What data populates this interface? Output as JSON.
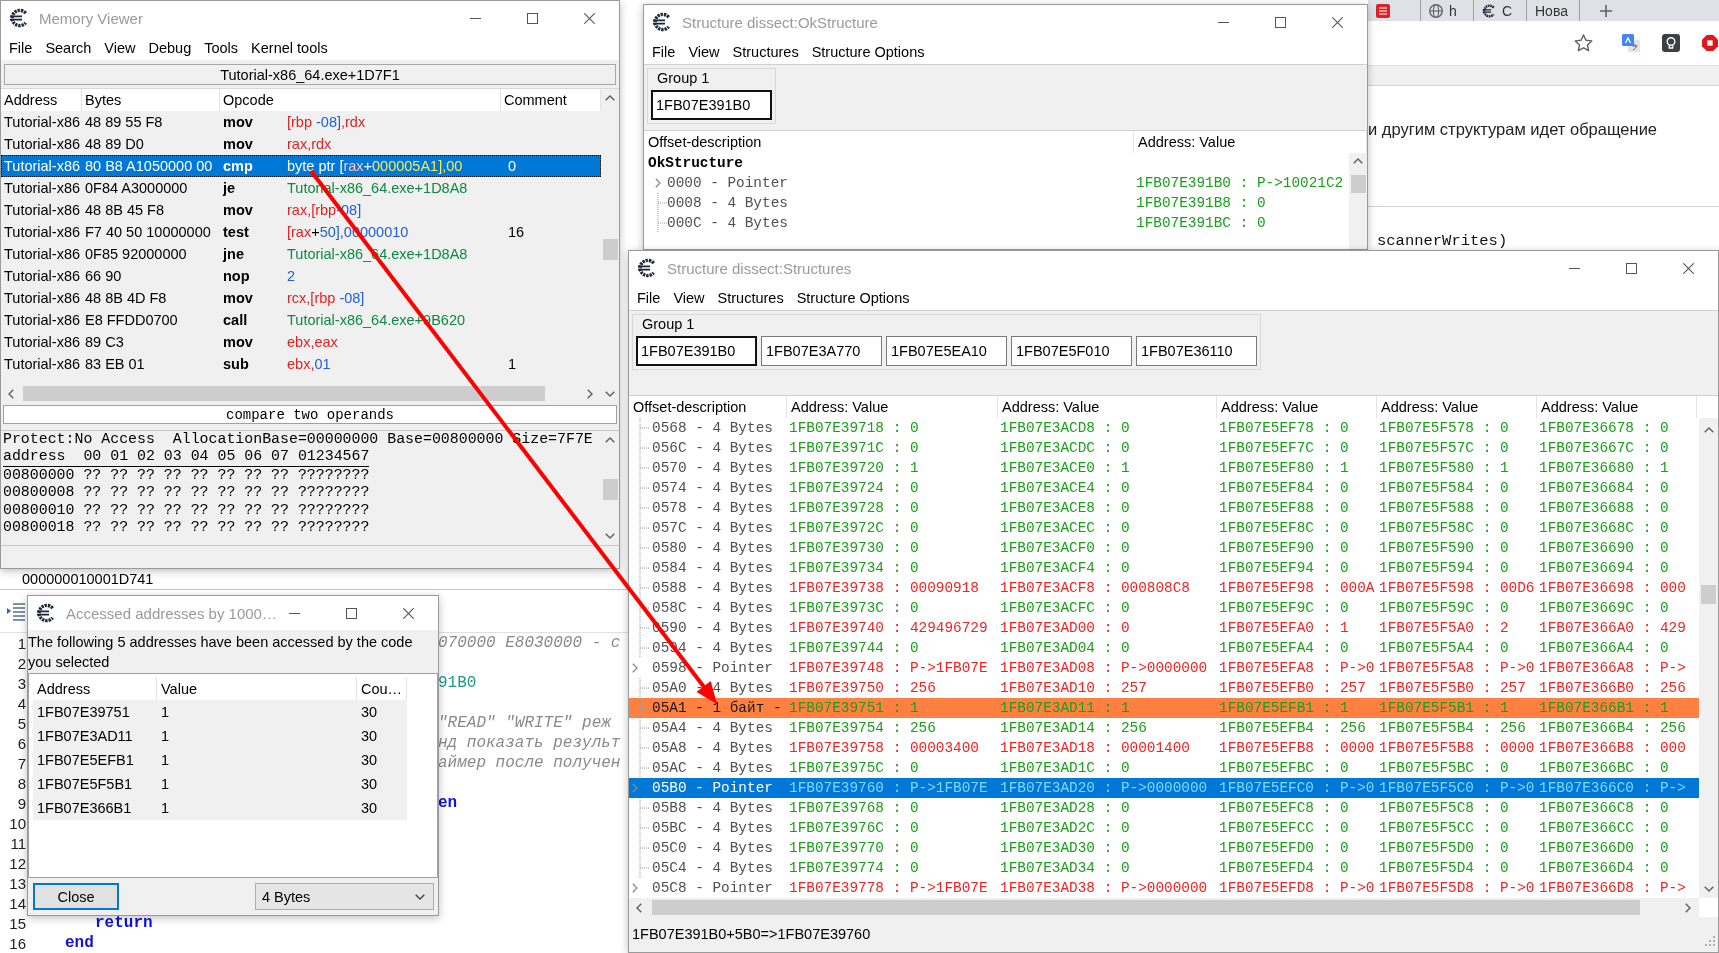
{
  "memory_viewer": {
    "title": "Memory Viewer",
    "menu": [
      "File",
      "Search",
      "View",
      "Debug",
      "Tools",
      "Kernel tools"
    ],
    "location": "Tutorial-x86_64.exe+1D7F1",
    "columns": [
      "Address",
      "Bytes",
      "Opcode",
      "Comment"
    ],
    "rows": [
      {
        "address": "Tutorial-x86",
        "bytes": "48 89 55 F8",
        "mnemonic": "mov",
        "operands": [
          {
            "kind": "reg",
            "text": "[rbp "
          },
          {
            "kind": "num",
            "text": "-08]"
          },
          {
            "kind": "reg",
            "text": ",rdx"
          }
        ],
        "selected": false
      },
      {
        "address": "Tutorial-x86",
        "bytes": "48 89 D0",
        "mnemonic": "mov",
        "operands": [
          {
            "kind": "reg",
            "text": "rax,rdx"
          }
        ],
        "selected": false
      },
      {
        "address": "Tutorial-x86",
        "bytes": "80 B8 A1050000 00",
        "mnemonic": "cmp",
        "operands": [
          {
            "kind": "txt",
            "text": "byte ptr ["
          },
          {
            "kind": "reg",
            "text": "rax"
          },
          {
            "kind": "txt",
            "text": "+"
          },
          {
            "kind": "num",
            "text": "000005A1],00"
          }
        ],
        "comment": "0",
        "selected": true
      },
      {
        "address": "Tutorial-x86",
        "bytes": "0F84 A3000000",
        "mnemonic": "je",
        "operands": [
          {
            "kind": "sym",
            "text": "Tutorial-x86_64.exe+1D8A8"
          }
        ],
        "selected": false
      },
      {
        "address": "Tutorial-x86",
        "bytes": "48 8B 45 F8",
        "mnemonic": "mov",
        "operands": [
          {
            "kind": "reg",
            "text": "rax,[rbp"
          },
          {
            "kind": "num",
            "text": "-08]"
          }
        ],
        "selected": false
      },
      {
        "address": "Tutorial-x86",
        "bytes": "F7 40 50 10000000",
        "mnemonic": "test",
        "operands": [
          {
            "kind": "reg",
            "text": "[rax"
          },
          {
            "kind": "txt",
            "text": "+"
          },
          {
            "kind": "num",
            "text": "50],00000010"
          }
        ],
        "comment": "16",
        "selected": false
      },
      {
        "address": "Tutorial-x86",
        "bytes": "0F85 92000000",
        "mnemonic": "jne",
        "operands": [
          {
            "kind": "sym",
            "text": "Tutorial-x86_64.exe+1D8A8"
          }
        ],
        "selected": false
      },
      {
        "address": "Tutorial-x86",
        "bytes": "66 90",
        "mnemonic": "nop",
        "operands": [
          {
            "kind": "num",
            "text": "2"
          }
        ],
        "selected": false
      },
      {
        "address": "Tutorial-x86",
        "bytes": "48 8B 4D F8",
        "mnemonic": "mov",
        "operands": [
          {
            "kind": "reg",
            "text": "rcx,[rbp "
          },
          {
            "kind": "num",
            "text": "-08]"
          }
        ],
        "selected": false
      },
      {
        "address": "Tutorial-x86",
        "bytes": "E8 FFDD0700",
        "mnemonic": "call",
        "operands": [
          {
            "kind": "sym",
            "text": "Tutorial-x86_64.exe+9B620"
          }
        ],
        "selected": false
      },
      {
        "address": "Tutorial-x86",
        "bytes": "89 C3",
        "mnemonic": "mov",
        "operands": [
          {
            "kind": "reg",
            "text": "ebx,eax"
          }
        ],
        "selected": false
      },
      {
        "address": "Tutorial-x86",
        "bytes": "83 EB 01",
        "mnemonic": "sub",
        "operands": [
          {
            "kind": "reg",
            "text": "ebx,"
          },
          {
            "kind": "num",
            "text": "01"
          }
        ],
        "comment": "1",
        "selected": false
      }
    ],
    "description": "compare two operands",
    "hex_view": {
      "info": "Protect:No Access  AllocationBase=00000000 Base=00800000 Size=7F7E",
      "header": "address  00 01 02 03 04 05 06 07 01234567",
      "rows": [
        "00800000 ?? ?? ?? ?? ?? ?? ?? ?? ????????",
        "00800008 ?? ?? ?? ?? ?? ?? ?? ?? ????????",
        "00800010 ?? ?? ?? ?? ?? ?? ?? ?? ????????",
        "00800018 ?? ?? ?? ?? ?? ?? ?? ?? ????????"
      ]
    }
  },
  "ok_structure_window": {
    "title": "Structure dissect:OkStructure",
    "menu": [
      "File",
      "View",
      "Structures",
      "Structure Options"
    ],
    "group": {
      "label": "Group 1",
      "addresses": [
        {
          "text": "1FB07E391B0",
          "focused": true
        }
      ]
    },
    "columns": [
      "Offset-description",
      "Address: Value"
    ],
    "tree": {
      "name": "OkStructure",
      "children": [
        {
          "label": "0000 - Pointer",
          "expandable": true,
          "value": "1FB07E391B0 : P->10021C2"
        },
        {
          "label": "0008 - 4 Bytes",
          "expandable": false,
          "value": "1FB07E391B8 : 0"
        },
        {
          "label": "000C - 4 Bytes",
          "expandable": false,
          "value": "1FB07E391BC : 0"
        }
      ]
    }
  },
  "browser": {
    "tabs": [
      {
        "kind": "pinned"
      },
      {
        "kind": "web",
        "title": "h"
      },
      {
        "kind": "app",
        "title": "C"
      },
      {
        "kind": "blank",
        "title": "Нова"
      }
    ],
    "page_text": "и другим структурам идет обращение",
    "code_text": "scannerWrites)"
  },
  "structures_window": {
    "title": "Structure dissect:Structures",
    "menu": [
      "File",
      "View",
      "Structures",
      "Structure Options"
    ],
    "group": {
      "label": "Group 1",
      "addresses": [
        {
          "text": "1FB07E391B0",
          "focused": true
        },
        {
          "text": "1FB07E3A770",
          "focused": false
        },
        {
          "text": "1FB07E5EA10",
          "focused": false
        },
        {
          "text": "1FB07E5F010",
          "focused": false
        },
        {
          "text": "1FB07E36110",
          "focused": false
        }
      ]
    },
    "offset_column": "Offset-description",
    "value_columns": [
      "Address: Value",
      "Address: Value",
      "Address: Value",
      "Address: Value",
      "Address: Value"
    ],
    "rows": [
      {
        "offset": "0568 - 4 Bytes",
        "expandable": false,
        "differs": false,
        "marked": false,
        "selected": false,
        "cells": [
          "1FB07E39718 : 0",
          "1FB07E3ACD8 : 0",
          "1FB07E5EF78 : 0",
          "1FB07E5F578 : 0",
          "1FB07E36678 : 0"
        ]
      },
      {
        "offset": "056C - 4 Bytes",
        "expandable": false,
        "differs": false,
        "marked": false,
        "selected": false,
        "cells": [
          "1FB07E3971C : 0",
          "1FB07E3ACDC : 0",
          "1FB07E5EF7C : 0",
          "1FB07E5F57C : 0",
          "1FB07E3667C : 0"
        ]
      },
      {
        "offset": "0570 - 4 Bytes",
        "expandable": false,
        "differs": false,
        "marked": false,
        "selected": false,
        "cells": [
          "1FB07E39720 : 1",
          "1FB07E3ACE0 : 1",
          "1FB07E5EF80 : 1",
          "1FB07E5F580 : 1",
          "1FB07E36680 : 1"
        ]
      },
      {
        "offset": "0574 - 4 Bytes",
        "expandable": false,
        "differs": false,
        "marked": false,
        "selected": false,
        "cells": [
          "1FB07E39724 : 0",
          "1FB07E3ACE4 : 0",
          "1FB07E5EF84 : 0",
          "1FB07E5F584 : 0",
          "1FB07E36684 : 0"
        ]
      },
      {
        "offset": "0578 - 4 Bytes",
        "expandable": false,
        "differs": false,
        "marked": false,
        "selected": false,
        "cells": [
          "1FB07E39728 : 0",
          "1FB07E3ACE8 : 0",
          "1FB07E5EF88 : 0",
          "1FB07E5F588 : 0",
          "1FB07E36688 : 0"
        ]
      },
      {
        "offset": "057C - 4 Bytes",
        "expandable": false,
        "differs": false,
        "marked": false,
        "selected": false,
        "cells": [
          "1FB07E3972C : 0",
          "1FB07E3ACEC : 0",
          "1FB07E5EF8C : 0",
          "1FB07E5F58C : 0",
          "1FB07E3668C : 0"
        ]
      },
      {
        "offset": "0580 - 4 Bytes",
        "expandable": false,
        "differs": false,
        "marked": false,
        "selected": false,
        "cells": [
          "1FB07E39730 : 0",
          "1FB07E3ACF0 : 0",
          "1FB07E5EF90 : 0",
          "1FB07E5F590 : 0",
          "1FB07E36690 : 0"
        ]
      },
      {
        "offset": "0584 - 4 Bytes",
        "expandable": false,
        "differs": false,
        "marked": false,
        "selected": false,
        "cells": [
          "1FB07E39734 : 0",
          "1FB07E3ACF4 : 0",
          "1FB07E5EF94 : 0",
          "1FB07E5F594 : 0",
          "1FB07E36694 : 0"
        ]
      },
      {
        "offset": "0588 - 4 Bytes",
        "expandable": false,
        "differs": true,
        "marked": false,
        "selected": false,
        "cells": [
          "1FB07E39738 : 00090918",
          "1FB07E3ACF8 : 000808C8",
          "1FB07E5EF98 : 000A",
          "1FB07E5F598 : 00D6",
          "1FB07E36698 : 000"
        ]
      },
      {
        "offset": "058C - 4 Bytes",
        "expandable": false,
        "differs": false,
        "marked": false,
        "selected": false,
        "cells": [
          "1FB07E3973C : 0",
          "1FB07E3ACFC : 0",
          "1FB07E5EF9C : 0",
          "1FB07E5F59C : 0",
          "1FB07E3669C : 0"
        ]
      },
      {
        "offset": "0590 - 4 Bytes",
        "expandable": false,
        "differs": true,
        "marked": false,
        "selected": false,
        "cells": [
          "1FB07E39740 : 429496729",
          "1FB07E3AD00 : 0",
          "1FB07E5EFA0 : 1",
          "1FB07E5F5A0 : 2",
          "1FB07E366A0 : 429"
        ]
      },
      {
        "offset": "0594 - 4 Bytes",
        "expandable": false,
        "differs": false,
        "marked": false,
        "selected": false,
        "cells": [
          "1FB07E39744 : 0",
          "1FB07E3AD04 : 0",
          "1FB07E5EFA4 : 0",
          "1FB07E5F5A4 : 0",
          "1FB07E366A4 : 0"
        ]
      },
      {
        "offset": "0598 - Pointer",
        "expandable": true,
        "differs": true,
        "marked": false,
        "selected": false,
        "cells": [
          "1FB07E39748 : P->1FB07E",
          "1FB07E3AD08 : P->0000000",
          "1FB07E5EFA8 : P->0",
          "1FB07E5F5A8 : P->0",
          "1FB07E366A8 : P->"
        ]
      },
      {
        "offset": "05A0 - 4 Bytes",
        "expandable": false,
        "differs": true,
        "marked": false,
        "selected": false,
        "cells": [
          "1FB07E39750 : 256",
          "1FB07E3AD10 : 257",
          "1FB07E5EFB0 : 257",
          "1FB07E5F5B0 : 257",
          "1FB07E366B0 : 256"
        ]
      },
      {
        "offset": "05A1 - 1 байт -",
        "expandable": false,
        "differs": false,
        "marked": true,
        "selected": false,
        "cells": [
          "1FB07E39751 : 1",
          "1FB07E3AD11 : 1",
          "1FB07E5EFB1 : 1",
          "1FB07E5F5B1 : 1",
          "1FB07E366B1 : 1"
        ]
      },
      {
        "offset": "05A4 - 4 Bytes",
        "expandable": false,
        "differs": false,
        "marked": false,
        "selected": false,
        "cells": [
          "1FB07E39754 : 256",
          "1FB07E3AD14 : 256",
          "1FB07E5EFB4 : 256",
          "1FB07E5F5B4 : 256",
          "1FB07E366B4 : 256"
        ]
      },
      {
        "offset": "05A8 - 4 Bytes",
        "expandable": false,
        "differs": true,
        "marked": false,
        "selected": false,
        "cells": [
          "1FB07E39758 : 00003400",
          "1FB07E3AD18 : 00001400",
          "1FB07E5EFB8 : 0000",
          "1FB07E5F5B8 : 0000",
          "1FB07E366B8 : 000"
        ]
      },
      {
        "offset": "05AC - 4 Bytes",
        "expandable": false,
        "differs": false,
        "marked": false,
        "selected": false,
        "cells": [
          "1FB07E3975C : 0",
          "1FB07E3AD1C : 0",
          "1FB07E5EFBC : 0",
          "1FB07E5F5BC : 0",
          "1FB07E366BC : 0"
        ]
      },
      {
        "offset": "05B0 - Pointer",
        "expandable": true,
        "differs": true,
        "marked": false,
        "selected": true,
        "cells": [
          "1FB07E39760 : P->1FB07E",
          "1FB07E3AD20 : P->0000000",
          "1FB07E5EFC0 : P->0",
          "1FB07E5F5C0 : P->0",
          "1FB07E366C0 : P->"
        ]
      },
      {
        "offset": "05B8 - 4 Bytes",
        "expandable": false,
        "differs": false,
        "marked": false,
        "selected": false,
        "cells": [
          "1FB07E39768 : 0",
          "1FB07E3AD28 : 0",
          "1FB07E5EFC8 : 0",
          "1FB07E5F5C8 : 0",
          "1FB07E366C8 : 0"
        ]
      },
      {
        "offset": "05BC - 4 Bytes",
        "expandable": false,
        "differs": false,
        "marked": false,
        "selected": false,
        "cells": [
          "1FB07E3976C : 0",
          "1FB07E3AD2C : 0",
          "1FB07E5EFCC : 0",
          "1FB07E5F5CC : 0",
          "1FB07E366CC : 0"
        ]
      },
      {
        "offset": "05C0 - 4 Bytes",
        "expandable": false,
        "differs": false,
        "marked": false,
        "selected": false,
        "cells": [
          "1FB07E39770 : 0",
          "1FB07E3AD30 : 0",
          "1FB07E5EFD0 : 0",
          "1FB07E5F5D0 : 0",
          "1FB07E366D0 : 0"
        ]
      },
      {
        "offset": "05C4 - 4 Bytes",
        "expandable": false,
        "differs": false,
        "marked": false,
        "selected": false,
        "cells": [
          "1FB07E39774 : 0",
          "1FB07E3AD34 : 0",
          "1FB07E5EFD4 : 0",
          "1FB07E5F5D4 : 0",
          "1FB07E366D4 : 0"
        ]
      },
      {
        "offset": "05C8 - Pointer",
        "expandable": true,
        "differs": true,
        "marked": false,
        "selected": false,
        "cells": [
          "1FB07E39778 : P->1FB07E",
          "1FB07E3AD38 : P->0000000",
          "1FB07E5EFD8 : P->0",
          "1FB07E5F5D8 : P->0",
          "1FB07E366D8 : P->"
        ]
      }
    ],
    "status": "1FB07E391B0+5B0=>1FB07E39760"
  },
  "script_editor": {
    "status_line": "000000010001D741",
    "lines": [
      {
        "number": "1",
        "text": "070000 E8030000 - с",
        "kind": "comment"
      },
      {
        "number": "2"
      },
      {
        "number": "3",
        "text": "91B0",
        "kind": "value"
      },
      {
        "number": "4"
      },
      {
        "number": "5",
        "text": "\"READ\" \"WRITE\" реж",
        "kind": "comment"
      },
      {
        "number": "6",
        "text": "нд показать результ",
        "kind": "comment"
      },
      {
        "number": "7",
        "text": "аймер после получен",
        "kind": "comment"
      },
      {
        "number": "8"
      },
      {
        "number": "9",
        "text": "en",
        "kind": "keyword"
      },
      {
        "number": "10"
      },
      {
        "number": "11"
      },
      {
        "number": "12"
      },
      {
        "number": "13"
      },
      {
        "number": "14"
      },
      {
        "number": "15",
        "text": "return",
        "kind": "body-keyword"
      },
      {
        "number": "16",
        "text": "end",
        "kind": "end-keyword"
      }
    ]
  },
  "accessed_dialog": {
    "title": "Accessed addresses by 1000…",
    "message": "The following 5 addresses have been accessed by the code you selected",
    "columns": [
      "Address",
      "Value",
      "Cou…"
    ],
    "rows": [
      {
        "address": "1FB07E39751",
        "value": "1",
        "count": "30"
      },
      {
        "address": "1FB07E3AD11",
        "value": "1",
        "count": "30"
      },
      {
        "address": "1FB07E5EFB1",
        "value": "1",
        "count": "30"
      },
      {
        "address": "1FB07E5F5B1",
        "value": "1",
        "count": "30"
      },
      {
        "address": "1FB07E366B1",
        "value": "1",
        "count": "30"
      }
    ],
    "close_button": "Close",
    "size_dropdown": "4 Bytes"
  }
}
